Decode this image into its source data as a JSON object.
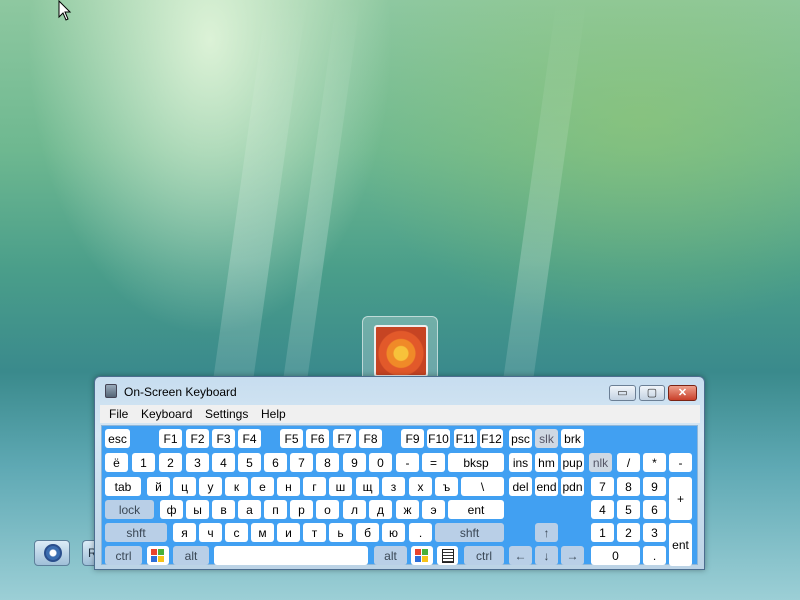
{
  "window": {
    "title": "On-Screen Keyboard",
    "controls": {
      "minimize": "▭",
      "maximize": "▢",
      "close": "✕"
    }
  },
  "menu": [
    "File",
    "Keyboard",
    "Settings",
    "Help"
  ],
  "keys": {
    "esc": "esc",
    "f1": "F1",
    "f2": "F2",
    "f3": "F3",
    "f4": "F4",
    "f5": "F5",
    "f6": "F6",
    "f7": "F7",
    "f8": "F8",
    "f9": "F9",
    "f10": "F10",
    "f11": "F11",
    "f12": "F12",
    "psc": "psc",
    "slk": "slk",
    "brk": "brk",
    "yo": "ё",
    "d1": "1",
    "d2": "2",
    "d3": "3",
    "d4": "4",
    "d5": "5",
    "d6": "6",
    "d7": "7",
    "d8": "8",
    "d9": "9",
    "d0": "0",
    "minus": "-",
    "equals": "=",
    "bksp": "bksp",
    "ins": "ins",
    "hm": "hm",
    "pup": "pup",
    "nlk": "nlk",
    "np_div": "/",
    "np_mul": "*",
    "np_sub": "-",
    "tab": "tab",
    "r2": [
      "й",
      "ц",
      "у",
      "к",
      "е",
      "н",
      "г",
      "ш",
      "щ",
      "з",
      "х",
      "ъ"
    ],
    "backslash": "\\",
    "del": "del",
    "end": "end",
    "pdn": "pdn",
    "np7": "7",
    "np8": "8",
    "np9": "9",
    "np_add": "+",
    "lock": "lock",
    "r3": [
      "ф",
      "ы",
      "в",
      "а",
      "п",
      "р",
      "о",
      "л",
      "д",
      "ж",
      "э"
    ],
    "ent": "ent",
    "np4": "4",
    "np5": "5",
    "np6": "6",
    "shft": "shft",
    "r4": [
      "я",
      "ч",
      "с",
      "м",
      "и",
      "т",
      "ь",
      "б",
      "ю",
      "."
    ],
    "up": "↑",
    "np1": "1",
    "np2": "2",
    "np3": "3",
    "np_ent": "ent",
    "ctrl": "ctrl",
    "alt": "alt",
    "left": "←",
    "down": "↓",
    "right": "→",
    "np0": "0",
    "np_dot": "."
  }
}
